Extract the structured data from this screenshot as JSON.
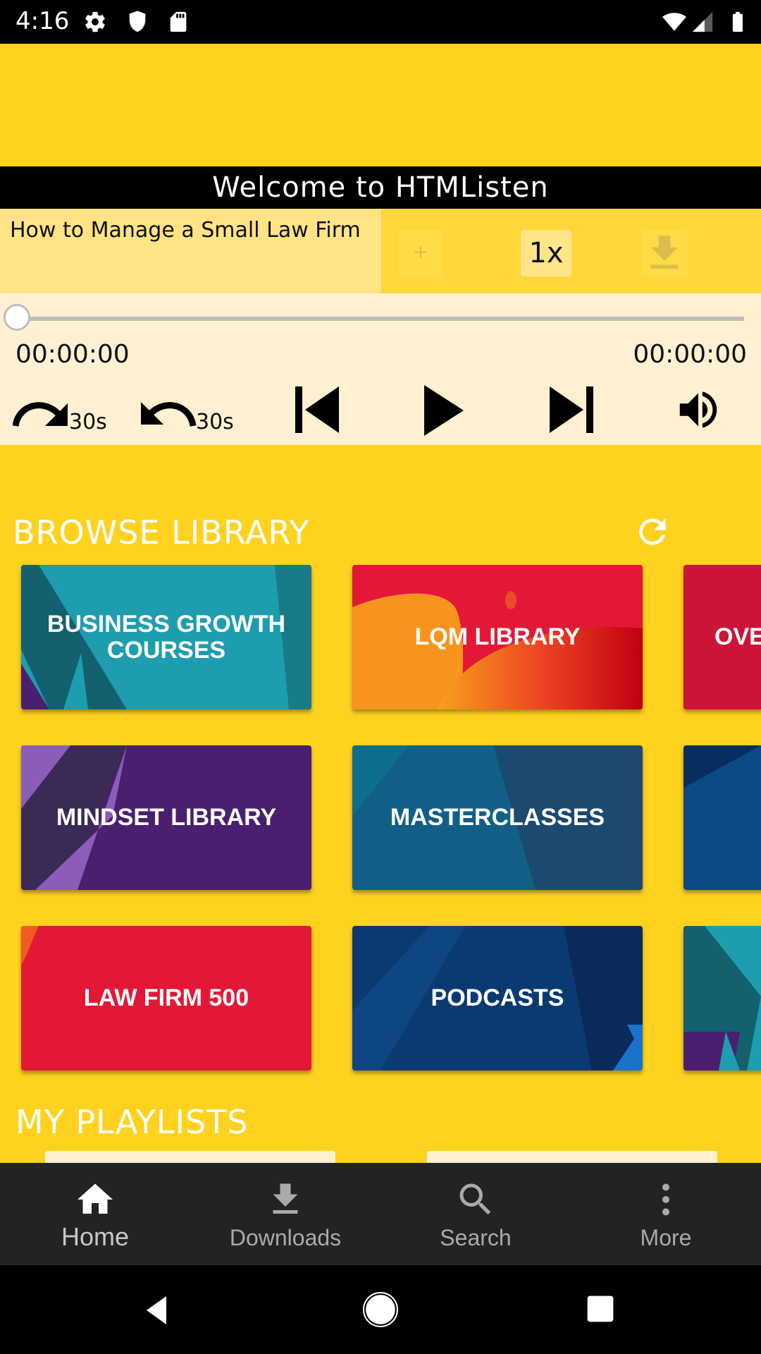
{
  "status_bar": {
    "time": "4:16",
    "left_icons": [
      "gear-icon",
      "shield-icon",
      "sd-card-icon"
    ],
    "right_icons": [
      "wifi-icon",
      "signal-icon",
      "battery-icon"
    ]
  },
  "header": {
    "welcome": "Welcome to HTMListen"
  },
  "now_playing": {
    "title": "How to Manage a Small Law Firm",
    "add_label": "+",
    "speed_label": "1x",
    "download_icon": "download-icon"
  },
  "player": {
    "progress": 0,
    "elapsed": "00:00:00",
    "duration": "00:00:00",
    "forward_label": "30s",
    "rewind_label": "30s",
    "controls": [
      "forward-30-icon",
      "rewind-30-icon",
      "skip-previous-icon",
      "play-icon",
      "skip-next-icon",
      "volume-icon"
    ]
  },
  "browse": {
    "title": "BROWSE LIBRARY",
    "refresh_icon": "refresh-icon",
    "cards": [
      {
        "label": "BUSINESS GROWTH COURSES",
        "color": "#1E9DAF"
      },
      {
        "label": "LQM LIBRARY",
        "color": "#E31837"
      },
      {
        "label": "OVE",
        "color": "#CC1438"
      },
      {
        "label": "MINDSET LIBRARY",
        "color": "#4A1F70"
      },
      {
        "label": "MASTERCLASSES",
        "color": "#115F86"
      },
      {
        "label": "",
        "color": "#0B4A87"
      },
      {
        "label": "LAW FIRM 500",
        "color": "#E31837"
      },
      {
        "label": "PODCASTS",
        "color": "#0B3A73"
      },
      {
        "label": "",
        "color": "#1E9DAF"
      }
    ]
  },
  "playlists": {
    "title": "MY PLAYLISTS"
  },
  "bottom_nav": {
    "items": [
      {
        "label": "Home",
        "icon": "home-icon",
        "active": true
      },
      {
        "label": "Downloads",
        "icon": "download-icon",
        "active": false
      },
      {
        "label": "Search",
        "icon": "search-icon",
        "active": false
      },
      {
        "label": "More",
        "icon": "more-vertical-icon",
        "active": false
      }
    ]
  },
  "system_nav": {
    "buttons": [
      "back-icon",
      "home-circle-icon",
      "recents-icon"
    ]
  }
}
